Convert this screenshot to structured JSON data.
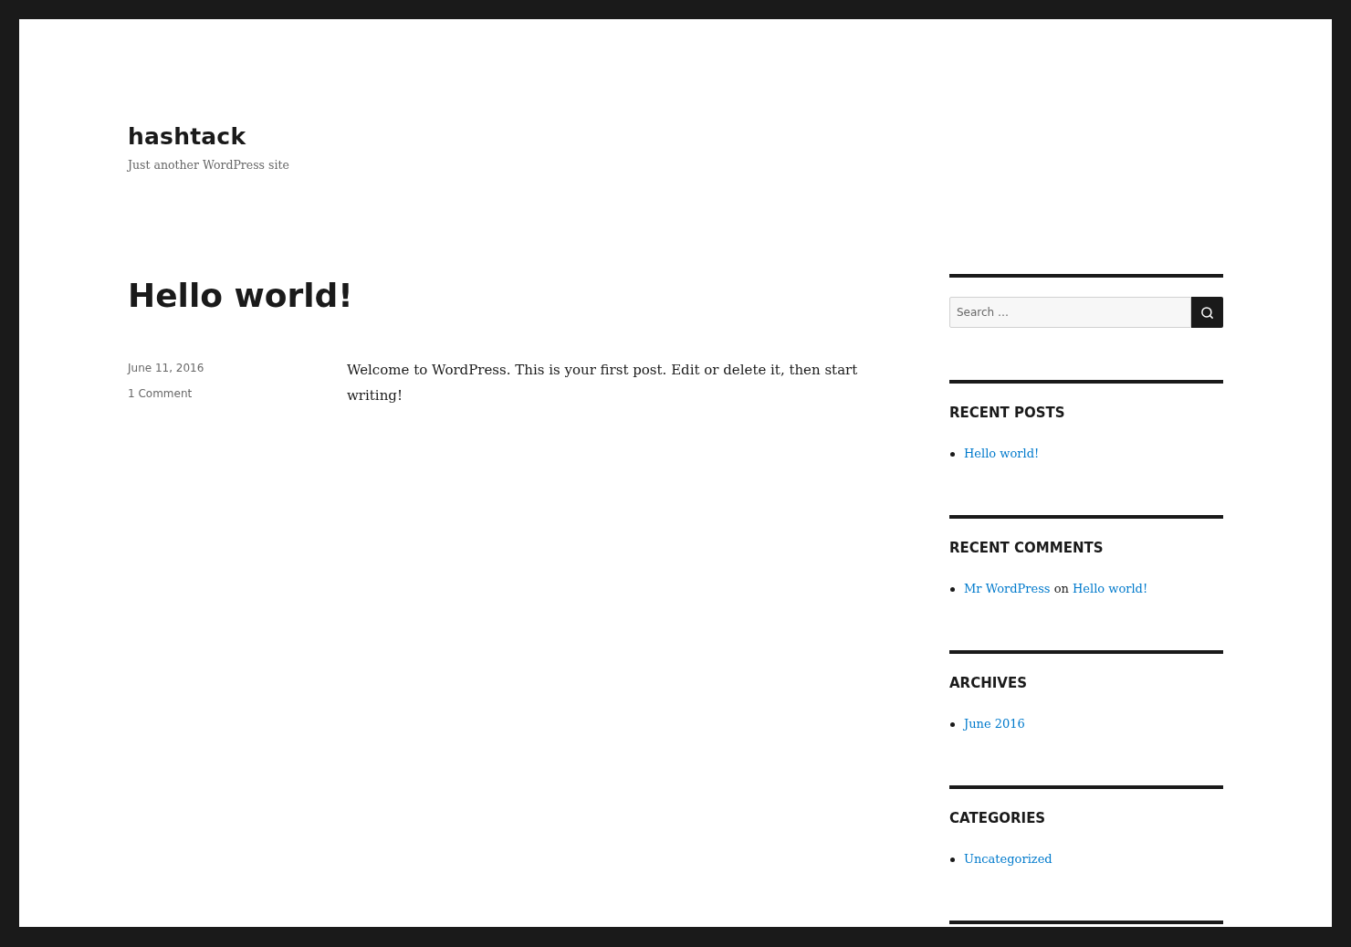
{
  "site": {
    "title": "hashtack",
    "tagline": "Just another WordPress site"
  },
  "post": {
    "title": "Hello world!",
    "date": "June 11, 2016",
    "comments": "1 Comment",
    "body": "Welcome to WordPress. This is your first post. Edit or delete it, then start writing!"
  },
  "sidebar": {
    "search": {
      "placeholder": "Search …"
    },
    "widgets": [
      {
        "title": "RECENT POSTS",
        "items": [
          {
            "segments": [
              {
                "kind": "link",
                "text": "Hello world!"
              }
            ]
          }
        ]
      },
      {
        "title": "RECENT COMMENTS",
        "items": [
          {
            "segments": [
              {
                "kind": "link",
                "text": "Mr WordPress"
              },
              {
                "kind": "text",
                "text": "on"
              },
              {
                "kind": "link",
                "text": "Hello world!"
              }
            ]
          }
        ]
      },
      {
        "title": "ARCHIVES",
        "items": [
          {
            "segments": [
              {
                "kind": "link",
                "text": "June 2016"
              }
            ]
          }
        ]
      },
      {
        "title": "CATEGORIES",
        "items": [
          {
            "segments": [
              {
                "kind": "link",
                "text": "Uncategorized"
              }
            ]
          }
        ]
      }
    ]
  }
}
